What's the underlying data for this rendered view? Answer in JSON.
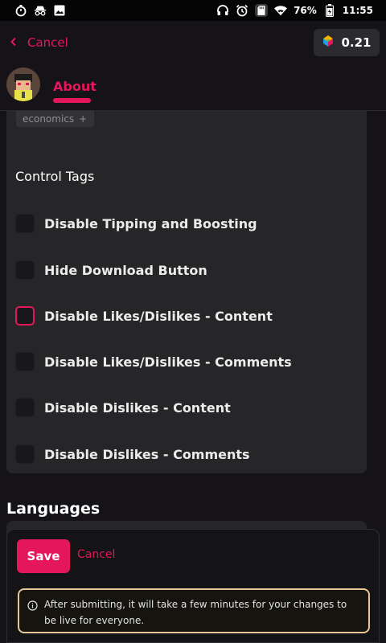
{
  "status_bar": {
    "battery": "76%",
    "time": "11:55",
    "left_icons": [
      "stopwatch-icon",
      "incognito-icon",
      "image-icon"
    ],
    "right_icons": [
      "headphones-icon",
      "alarm-icon",
      "sd-card-icon",
      "wifi-icon",
      "battery-icon"
    ]
  },
  "header": {
    "cancel_label": "Cancel",
    "wallet_balance": "0.21",
    "tab_label": "About"
  },
  "tags": {
    "chip_label": "economics",
    "chip_add": "+"
  },
  "control_tags": {
    "title": "Control Tags",
    "items": [
      {
        "label": "Disable Tipping and Boosting",
        "checked": false,
        "focused": false
      },
      {
        "label": "Hide Download Button",
        "checked": false,
        "focused": false
      },
      {
        "label": "Disable Likes/Dislikes - Content",
        "checked": false,
        "focused": true
      },
      {
        "label": "Disable Likes/Dislikes - Comments",
        "checked": false,
        "focused": false
      },
      {
        "label": "Disable Dislikes - Content",
        "checked": false,
        "focused": false
      },
      {
        "label": "Disable Dislikes - Comments",
        "checked": false,
        "focused": false
      }
    ]
  },
  "languages": {
    "title": "Languages"
  },
  "actions": {
    "save_label": "Save",
    "cancel_label": "Cancel",
    "notice": "After submitting, it will take a few minutes for your changes to be live for everyone."
  },
  "colors": {
    "accent": "#e4175c",
    "notice_border": "#e7c79a",
    "background": "#161318",
    "card": "#262628"
  }
}
